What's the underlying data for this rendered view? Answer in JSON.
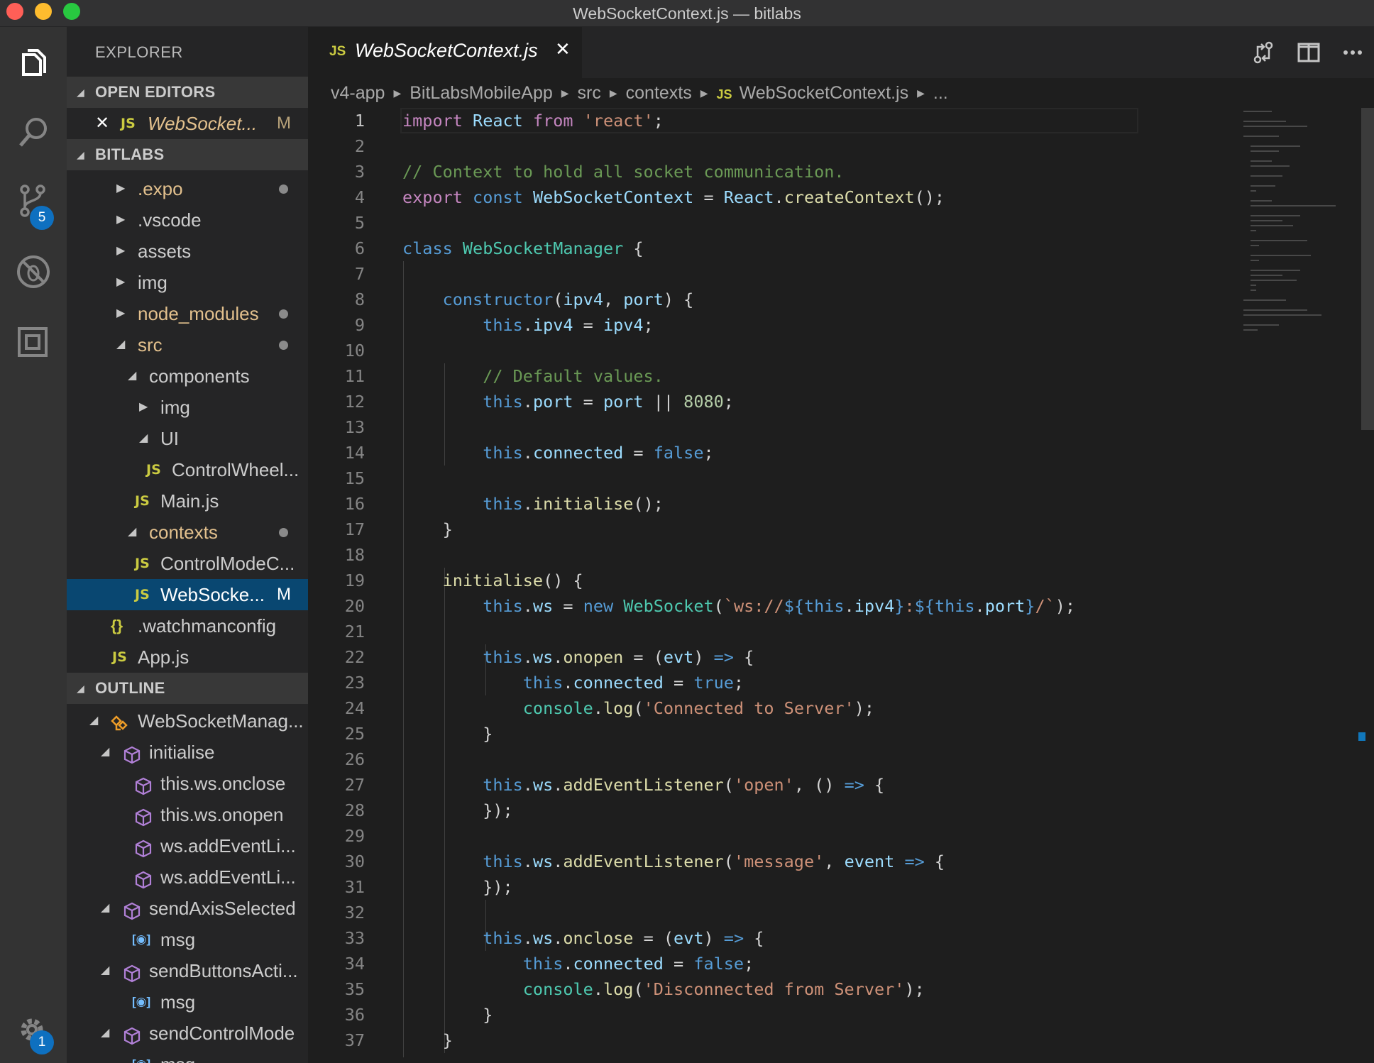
{
  "window": {
    "title": "WebSocketContext.js — bitlabs"
  },
  "activity_bar": {
    "items": [
      {
        "icon": "files-icon"
      },
      {
        "icon": "search-icon"
      },
      {
        "icon": "source-control-icon",
        "badge": "5"
      },
      {
        "icon": "debug-icon"
      },
      {
        "icon": "extensions-icon"
      }
    ],
    "settings_badge": "1"
  },
  "sidebar": {
    "title": "EXPLORER",
    "open_editors": {
      "header": "OPEN EDITORS",
      "items": [
        {
          "name": "WebSocket...",
          "status": "M"
        }
      ]
    },
    "project": {
      "header": "BITLABS",
      "tree": [
        {
          "name": ".expo"
        },
        {
          "name": ".vscode"
        },
        {
          "name": "assets"
        },
        {
          "name": "img"
        },
        {
          "name": "node_modules"
        },
        {
          "name": "src"
        },
        {
          "name": "components"
        },
        {
          "name": "img"
        },
        {
          "name": "UI"
        },
        {
          "name": "ControlWheel..."
        },
        {
          "name": "Main.js"
        },
        {
          "name": "contexts"
        },
        {
          "name": "ControlModeC..."
        },
        {
          "name": "WebSocke...",
          "status": "M"
        },
        {
          "name": ".watchmanconfig"
        },
        {
          "name": "App.js"
        }
      ]
    },
    "outline": {
      "header": "OUTLINE",
      "items": [
        {
          "name": "WebSocketManag..."
        },
        {
          "name": "initialise"
        },
        {
          "name": "this.ws.onclose"
        },
        {
          "name": "this.ws.onopen"
        },
        {
          "name": "ws.addEventLi..."
        },
        {
          "name": "ws.addEventLi..."
        },
        {
          "name": "sendAxisSelected"
        },
        {
          "name": "msg"
        },
        {
          "name": "sendButtonsActi..."
        },
        {
          "name": "msg"
        },
        {
          "name": "sendControlMode"
        },
        {
          "name": "msg"
        }
      ]
    }
  },
  "editor": {
    "tab": {
      "lang": "JS",
      "name": "WebSocketContext.js",
      "close": "✕"
    },
    "breadcrumb": {
      "parts": [
        "v4-app",
        "BitLabsMobileApp",
        "src",
        "contexts"
      ],
      "file": "WebSocketContext.js",
      "more": "..."
    },
    "line_numbers": [
      "1",
      "2",
      "3",
      "4",
      "5",
      "6",
      "7",
      "8",
      "9",
      "10",
      "11",
      "12",
      "13",
      "14",
      "15",
      "16",
      "17",
      "18",
      "19",
      "20",
      "21",
      "22",
      "23",
      "24",
      "25",
      "26",
      "27",
      "28",
      "29",
      "30",
      "31",
      "32",
      "33",
      "34",
      "35",
      "36",
      "37"
    ],
    "current_line": 1,
    "colors": {
      "background": "#1e1e1e",
      "keyword": "#c586c0",
      "storage": "#569cd6",
      "function": "#dcdcaa",
      "class": "#4ec9b0",
      "variable": "#9cdcfe",
      "string": "#ce9178",
      "comment": "#6a9955",
      "number": "#b5cea8",
      "selection": "#094771"
    },
    "tokens": {
      "import": "import",
      "React": "React",
      "from": "from",
      "react_str": "'react'",
      "semi": ";",
      "comment1": "// Context to hold all socket communication.",
      "export": "export",
      "const": "const",
      "ctx": "WebSocketContext",
      "eq": " = ",
      "createContext": "createContext",
      "call_end": "();",
      "class": "class",
      "manager": "WebSocketManager",
      "brace_open": " {",
      "constructor": "constructor",
      "ipv4": "ipv4",
      "port": "port",
      "this": "this",
      "comment2": "// Default values.",
      "or": " || ",
      "num8080": "8080",
      "connected": "connected",
      "false": "false",
      "true": "true",
      "initialise": "initialise",
      "brace_close": "}",
      "ws": "ws",
      "new": "new",
      "WebSocket": "WebSocket",
      "tpl_start": "`ws://",
      "tpl_open": "${",
      "tpl_close": "}",
      "colon": ":",
      "tpl_end": "/`",
      "onopen": "onopen",
      "evt": "evt",
      "arrow": "=>",
      "console": "console",
      "log": "log",
      "connected_str": "'Connected to Server'",
      "addEventListener": "addEventListener",
      "open_str": "'open'",
      "message_str": "'message'",
      "event": "event",
      "onclose": "onclose",
      "disconnected_str": "'Disconnected from Server'",
      "close_obj": "});"
    }
  }
}
